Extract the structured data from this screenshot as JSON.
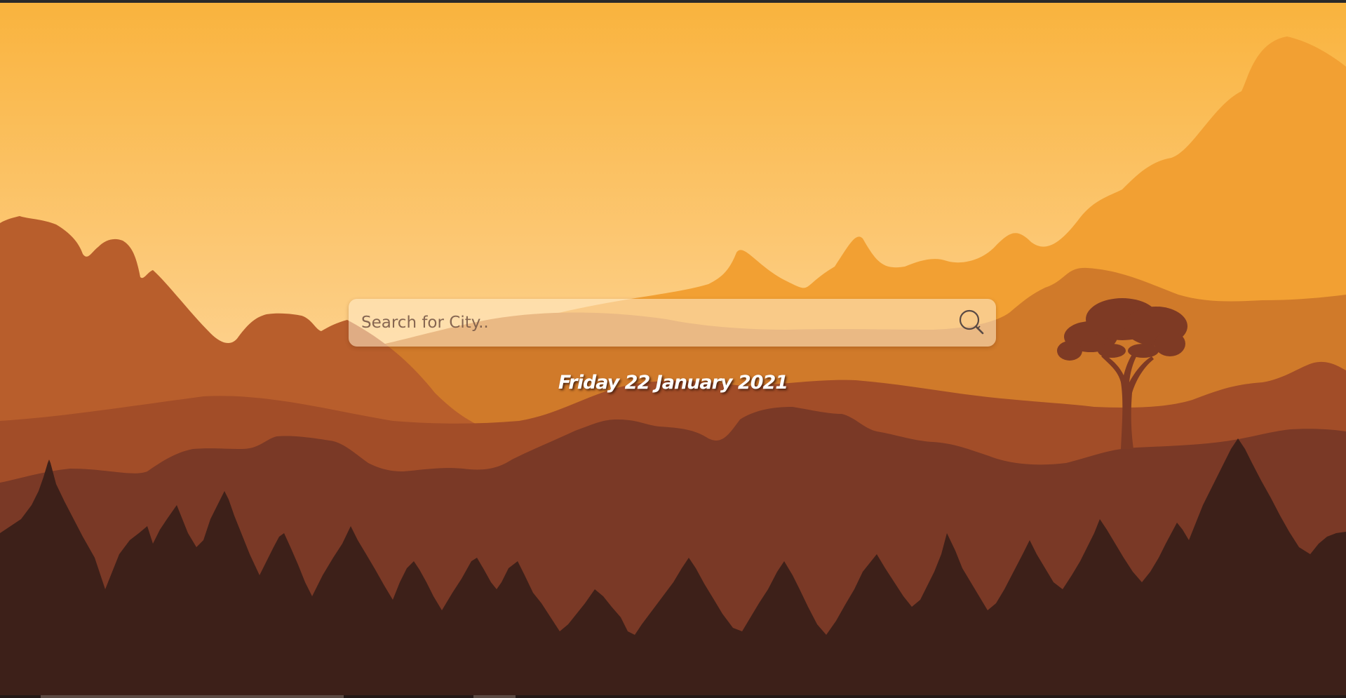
{
  "search": {
    "placeholder": "Search for City..",
    "value": "",
    "icon": "search-icon"
  },
  "date": {
    "text": "Friday 22 January 2021"
  },
  "colors": {
    "sky_top": "#F9B33D",
    "sky_bottom": "#FDD08A",
    "far_mountain": "#F2A033",
    "mid_mountain": "#D07A2A",
    "left_hill": "#B85E2C",
    "hill_band": "#A24D28",
    "foothills": "#7A3926",
    "forest": "#3D2019",
    "tree": "#7E3A24"
  }
}
